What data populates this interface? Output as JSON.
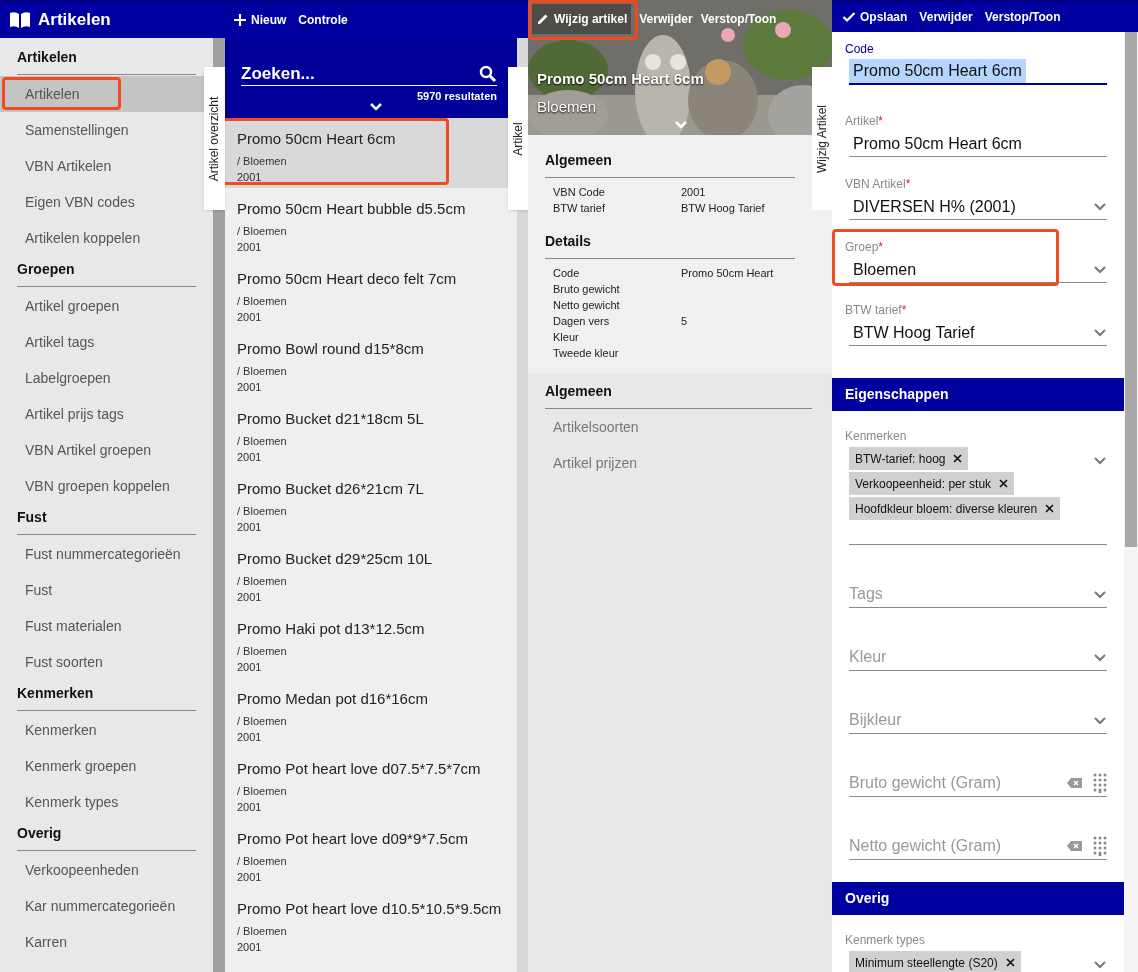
{
  "app": {
    "title": "Artikelen"
  },
  "list_toolbar": [
    {
      "label": "Nieuw"
    },
    {
      "label": "Controle"
    }
  ],
  "sidebar": [
    {
      "title": "Artikelen",
      "items": [
        {
          "label": "Artikelen",
          "selected": true,
          "highlighted": true
        },
        {
          "label": "Samenstellingen",
          "selected": false,
          "highlighted": false
        },
        {
          "label": "VBN Artikelen",
          "selected": false,
          "highlighted": false
        },
        {
          "label": "Eigen VBN codes",
          "selected": false,
          "highlighted": false
        },
        {
          "label": "Artikelen koppelen",
          "selected": false,
          "highlighted": false
        }
      ]
    },
    {
      "title": "Groepen",
      "items": [
        {
          "label": "Artikel groepen",
          "selected": false,
          "highlighted": false
        },
        {
          "label": "Artikel tags",
          "selected": false,
          "highlighted": false
        },
        {
          "label": "Labelgroepen",
          "selected": false,
          "highlighted": false
        },
        {
          "label": "Artikel prijs tags",
          "selected": false,
          "highlighted": false
        },
        {
          "label": "VBN Artikel groepen",
          "selected": false,
          "highlighted": false
        },
        {
          "label": "VBN groepen koppelen",
          "selected": false,
          "highlighted": false
        }
      ]
    },
    {
      "title": "Fust",
      "items": [
        {
          "label": "Fust nummercategorieën",
          "selected": false,
          "highlighted": false
        },
        {
          "label": "Fust",
          "selected": false,
          "highlighted": false
        },
        {
          "label": "Fust materialen",
          "selected": false,
          "highlighted": false
        },
        {
          "label": "Fust soorten",
          "selected": false,
          "highlighted": false
        }
      ]
    },
    {
      "title": "Kenmerken",
      "items": [
        {
          "label": "Kenmerken",
          "selected": false,
          "highlighted": false
        },
        {
          "label": "Kenmerk groepen",
          "selected": false,
          "highlighted": false
        },
        {
          "label": "Kenmerk types",
          "selected": false,
          "highlighted": false
        }
      ]
    },
    {
      "title": "Overig",
      "items": [
        {
          "label": "Verkoopeenheden",
          "selected": false,
          "highlighted": false
        },
        {
          "label": "Kar nummercategorieën",
          "selected": false,
          "highlighted": false
        },
        {
          "label": "Karren",
          "selected": false,
          "highlighted": false
        }
      ]
    }
  ],
  "list_tab": "Artikel overzicht",
  "search": {
    "placeholder": "Zoeken...",
    "results": "5970 resultaten"
  },
  "articles": [
    {
      "name": "Promo 50cm Heart 6cm",
      "group": "/ Bloemen",
      "code": "2001",
      "selected": true,
      "highlighted": true
    },
    {
      "name": "Promo 50cm Heart bubble d5.5cm",
      "group": "/ Bloemen",
      "code": "2001",
      "selected": false,
      "highlighted": false
    },
    {
      "name": "Promo 50cm Heart deco felt 7cm",
      "group": "/ Bloemen",
      "code": "2001",
      "selected": false,
      "highlighted": false
    },
    {
      "name": "Promo Bowl round d15*8cm",
      "group": "/ Bloemen",
      "code": "2001",
      "selected": false,
      "highlighted": false
    },
    {
      "name": "Promo Bucket d21*18cm 5L",
      "group": "/ Bloemen",
      "code": "2001",
      "selected": false,
      "highlighted": false
    },
    {
      "name": "Promo Bucket d26*21cm 7L",
      "group": "/ Bloemen",
      "code": "2001",
      "selected": false,
      "highlighted": false
    },
    {
      "name": "Promo Bucket d29*25cm 10L",
      "group": "/ Bloemen",
      "code": "2001",
      "selected": false,
      "highlighted": false
    },
    {
      "name": "Promo Haki pot d13*12.5cm",
      "group": "/ Bloemen",
      "code": "2001",
      "selected": false,
      "highlighted": false
    },
    {
      "name": "Promo Medan pot d16*16cm",
      "group": "/ Bloemen",
      "code": "2001",
      "selected": false,
      "highlighted": false
    },
    {
      "name": "Promo Pot heart love d07.5*7.5*7cm",
      "group": "/ Bloemen",
      "code": "2001",
      "selected": false,
      "highlighted": false
    },
    {
      "name": "Promo Pot heart love d09*9*7.5cm",
      "group": "/ Bloemen",
      "code": "2001",
      "selected": false,
      "highlighted": false
    },
    {
      "name": "Promo Pot heart love d10.5*10.5*9.5cm",
      "group": "/ Bloemen",
      "code": "2001",
      "selected": false,
      "highlighted": false
    }
  ],
  "detail": {
    "toolbar": [
      {
        "label": "Wijzig artikel",
        "highlighted": true
      },
      {
        "label": "Verwijder",
        "highlighted": false
      },
      {
        "label": "Verstop/Toon",
        "highlighted": false
      }
    ],
    "title": "Promo 50cm Heart 6cm",
    "subtitle": "Bloemen",
    "tab": "Artikel",
    "side_tab": "Wijzig Artikel",
    "sections": [
      {
        "title": "Algemeen",
        "rows": [
          {
            "label": "VBN Code",
            "value": "2001"
          },
          {
            "label": "BTW tarief",
            "value": "BTW Hoog Tarief"
          }
        ]
      },
      {
        "title": "Details",
        "rows": [
          {
            "label": "Code",
            "value": "Promo 50cm Heart"
          },
          {
            "label": "Bruto gewicht"
          },
          {
            "label": "Netto gewicht"
          },
          {
            "label": "Dagen vers",
            "value": "5"
          },
          {
            "label": "Kleur"
          },
          {
            "label": "Tweede kleur"
          }
        ]
      }
    ],
    "links": {
      "title": "Algemeen",
      "items": [
        "Artikelsoorten",
        "Artikel prijzen"
      ]
    }
  },
  "form": {
    "toolbar": [
      {
        "label": "Opslaan"
      },
      {
        "label": "Verwijder"
      },
      {
        "label": "Verstop/Toon"
      }
    ],
    "items": [
      {
        "kind": "input",
        "label": "Code",
        "value": "Promo 50cm Heart 6cm",
        "focused": true
      },
      {
        "kind": "input",
        "label": "Artikel",
        "mark": "*",
        "value": "Promo 50cm Heart 6cm",
        "focused": false
      },
      {
        "kind": "select",
        "label": "VBN Artikel",
        "mark": "*",
        "value": "DIVERSEN H% (2001)",
        "focused": false
      },
      {
        "kind": "select",
        "label": "Groep",
        "mark": "*",
        "value": "Bloemen",
        "focused": false,
        "highlighted": true
      },
      {
        "kind": "select",
        "label": "BTW tarief",
        "mark": "*",
        "value": "BTW Hoog Tarief",
        "focused": false
      },
      {
        "kind": "section",
        "label": "Eigenschappen"
      },
      {
        "kind": "chips",
        "label": "Kenmerken",
        "chips": [
          "BTW-tarief: hoog",
          "Verkoopeenheid: per stuk",
          "Hoofdkleur bloem: diverse kleuren"
        ]
      },
      {
        "kind": "select",
        "placeholder": "Tags"
      },
      {
        "kind": "select",
        "placeholder": "Kleur"
      },
      {
        "kind": "select",
        "placeholder": "Bijkleur"
      },
      {
        "kind": "number",
        "placeholder": "Bruto gewicht (Gram)"
      },
      {
        "kind": "number",
        "placeholder": "Netto gewicht (Gram)"
      },
      {
        "kind": "section",
        "label": "Overig"
      },
      {
        "kind": "chips",
        "label": "Kenmerk types",
        "chips": [
          "Minimum steellengte (S20)"
        ]
      }
    ]
  }
}
